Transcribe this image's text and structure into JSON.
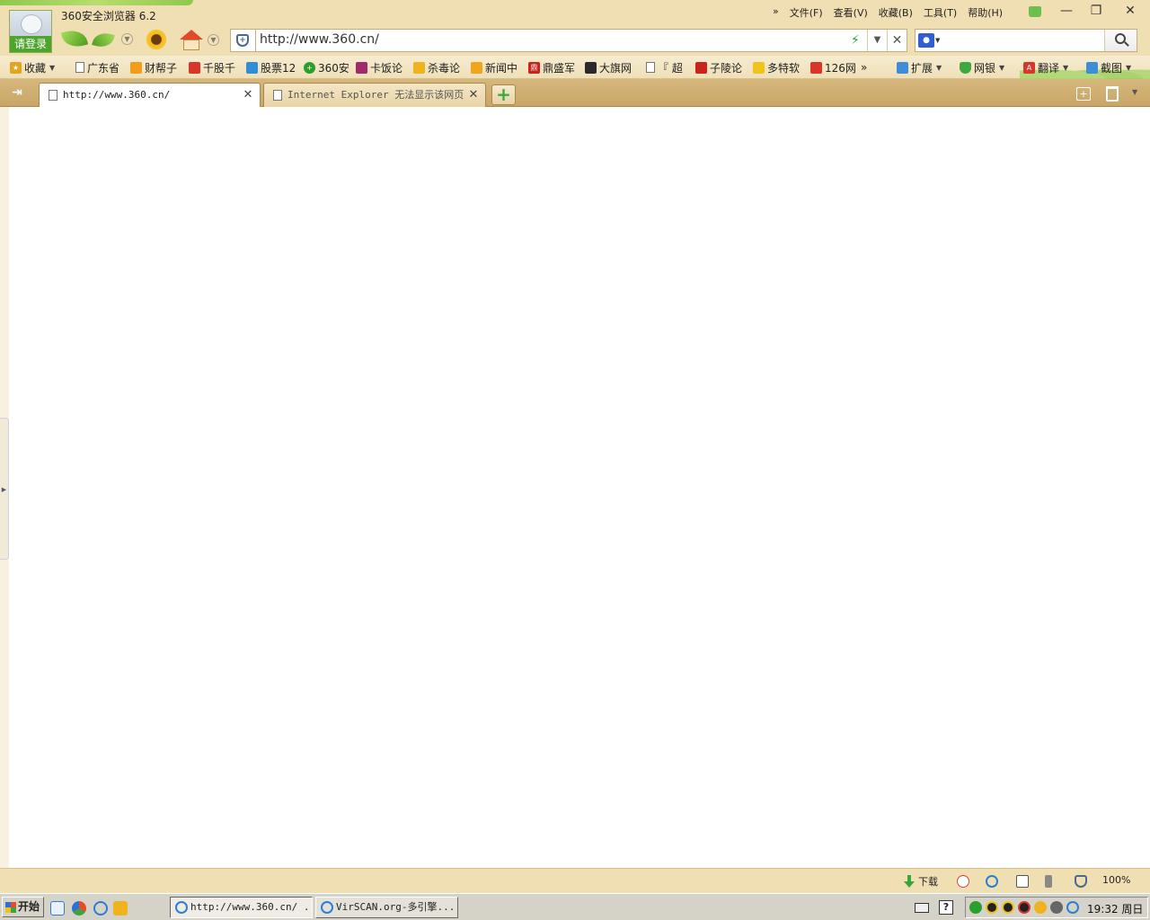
{
  "window": {
    "title": "360安全浏览器 6.2",
    "login_label": "请登录",
    "menu": [
      "»",
      "文件(F)",
      "查看(V)",
      "收藏(B)",
      "工具(T)",
      "帮助(H)"
    ],
    "controls": {
      "minimize": "—",
      "restore": "❐",
      "close": "✕"
    }
  },
  "address": {
    "url": "http://www.360.cn/",
    "dropdown_glyph": "▼",
    "stop_glyph": "✕",
    "lightning_glyph": "⚡"
  },
  "search": {
    "engine_icon": "baidu-paw-icon",
    "placeholder": ""
  },
  "bookmarks": [
    {
      "label": "收藏",
      "icon": "favorites-star-icon",
      "color": "#e2a51b",
      "caret": true
    },
    {
      "label": "广东省",
      "icon": "page-icon"
    },
    {
      "label": "财帮子",
      "icon": "caibangzi-icon",
      "color": "#f29c1b"
    },
    {
      "label": "千股千",
      "icon": "qiangu-icon",
      "color": "#d8362a"
    },
    {
      "label": "股票12",
      "icon": "gupiao-icon",
      "color": "#2f8ed6"
    },
    {
      "label": "360安",
      "icon": "360-icon",
      "color": "#2c9e2c"
    },
    {
      "label": "卡饭论",
      "icon": "kafan-icon",
      "color": "#a12a6a"
    },
    {
      "label": "杀毒论",
      "icon": "shadu-icon",
      "color": "#f1b31b"
    },
    {
      "label": "新闻中",
      "icon": "news-hand-icon",
      "color": "#f1a51b"
    },
    {
      "label": "鼎盛军",
      "icon": "dingsheng-icon",
      "color": "#c9231b"
    },
    {
      "label": "大旗网",
      "icon": "daqi-icon",
      "color": "#2a2a2a"
    },
    {
      "label": "『 超",
      "icon": "page-icon"
    },
    {
      "label": "子陵论",
      "icon": "ziling-icon",
      "color": "#c9231b"
    },
    {
      "label": "多特软",
      "icon": "duote-icon",
      "color": "#f1c41b"
    },
    {
      "label": "126网",
      "icon": "126-icon",
      "color": "#d8362a"
    },
    {
      "label": "»",
      "icon": ""
    }
  ],
  "bookmark_tools": [
    {
      "label": "扩展",
      "icon": "extensions-icon",
      "color": "#3d8ed6",
      "caret": true
    },
    {
      "label": "网银",
      "icon": "bank-shield-icon",
      "color": "#3ea83e",
      "caret": true
    },
    {
      "label": "翻译",
      "icon": "translate-icon",
      "color": "#d8362a",
      "caret": true
    },
    {
      "label": "截图",
      "icon": "screenshot-icon",
      "color": "#3d8ed6",
      "caret": true
    }
  ],
  "tabs": [
    {
      "title": "http://www.360.cn/",
      "active": true
    },
    {
      "title": "Internet Explorer 无法显示该网页",
      "active": false
    }
  ],
  "tab_close_glyph": "✕",
  "new_tab_glyph": "+",
  "statusbar": {
    "download_label": "下载",
    "zoom": "100%"
  },
  "taskbar": {
    "start_label": "开始",
    "tasks": [
      {
        "title": "http://www.360.cn/ ...",
        "pressed": true
      },
      {
        "title": "VirSCAN.org-多引擎...",
        "pressed": false
      }
    ],
    "help_glyph": "?",
    "clock": "19:32 周日"
  },
  "colors": {
    "chrome_bg": "#f1dfb4",
    "tabbar_bg": "#c9a666",
    "accent_green": "#3ea83e",
    "taskbar_bg": "#d5d2c8"
  }
}
